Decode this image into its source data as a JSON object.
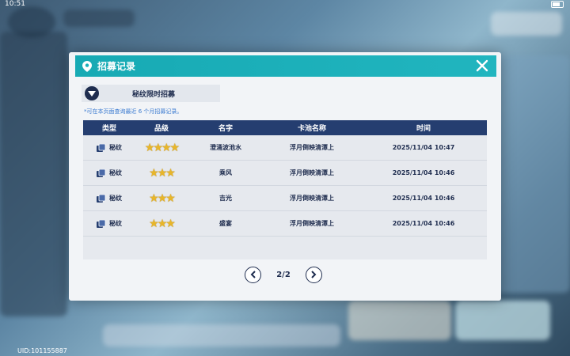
{
  "status": {
    "time": "10:51"
  },
  "uid": "UID:101155887",
  "modal": {
    "title": "招募记录",
    "filter_label": "秘纹限时招募",
    "note": "*可在本页面查询最近 6 个月招募记录。",
    "columns": [
      "类型",
      "品级",
      "名字",
      "卡池名称",
      "时间"
    ],
    "rows": [
      {
        "type": "秘纹",
        "stars": "★★★★",
        "rating": 4,
        "name": "澄涌波池水",
        "pool": "浮月倒映清潭上",
        "time": "2025/11/04 10:47"
      },
      {
        "type": "秘纹",
        "stars": "★★★",
        "rating": 3,
        "name": "乘风",
        "pool": "浮月倒映清潭上",
        "time": "2025/11/04 10:46"
      },
      {
        "type": "秘纹",
        "stars": "★★★",
        "rating": 3,
        "name": "吉光",
        "pool": "浮月倒映清潭上",
        "time": "2025/11/04 10:46"
      },
      {
        "type": "秘纹",
        "stars": "★★★",
        "rating": 3,
        "name": "盛宴",
        "pool": "浮月倒映清潭上",
        "time": "2025/11/04 10:46"
      }
    ],
    "page": "2/2"
  },
  "icons": [
    "location-pin-icon",
    "close-icon",
    "chevron-down-icon",
    "card-type-icon",
    "prev-page-icon",
    "next-page-icon"
  ]
}
